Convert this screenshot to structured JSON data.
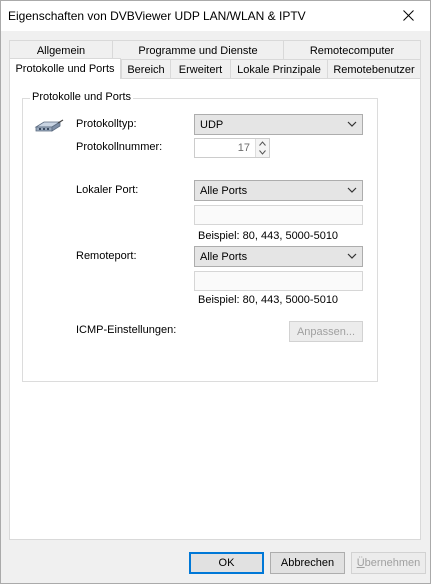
{
  "window": {
    "title": "Eigenschaften von DVBViewer UDP LAN/WLAN & IPTV",
    "close_glyph": "✕"
  },
  "tabs": {
    "row1": [
      "Allgemein",
      "Programme und Dienste",
      "Remotecomputer"
    ],
    "row2": [
      "Protokolle und Ports",
      "Bereich",
      "Erweitert",
      "Lokale Prinzipale",
      "Remotebenutzer"
    ],
    "active": "Protokolle und Ports"
  },
  "group": {
    "title": "Protokolle und Ports",
    "icon": "network-cable-icon",
    "protocol_type_label": "Protokolltyp:",
    "protocol_type_value": "UDP",
    "protocol_number_label": "Protokollnummer:",
    "protocol_number_value": "17",
    "local_port_label": "Lokaler Port:",
    "local_port_value": "Alle Ports",
    "local_port_text": "",
    "local_port_example": "Beispiel: 80, 443, 5000-5010",
    "remote_port_label": "Remoteport:",
    "remote_port_value": "Alle Ports",
    "remote_port_text": "",
    "remote_port_example": "Beispiel: 80, 443, 5000-5010",
    "icmp_label": "ICMP-Einstellungen:",
    "icmp_button": "Anpassen..."
  },
  "footer": {
    "ok": "OK",
    "cancel": "Abbrechen",
    "apply_prefix": "Ü",
    "apply_rest": "bernehmen"
  },
  "colors": {
    "accent": "#0078d7",
    "disabled_text": "#a0a0a0"
  }
}
